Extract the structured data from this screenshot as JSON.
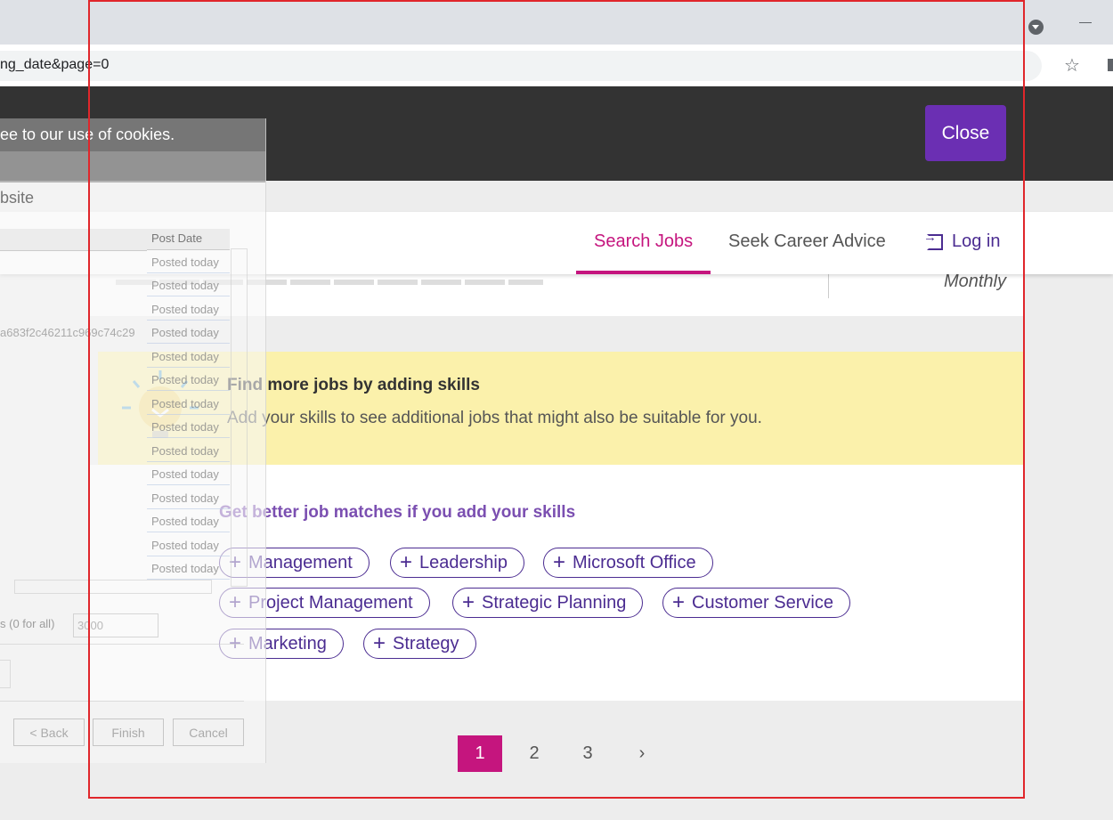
{
  "browser": {
    "url_fragment": "ng_date&page=0",
    "bookmark_icon": "star-icon",
    "profile_icon": "profile-dropdown-icon"
  },
  "cookie_banner": {
    "message": "ee to our use of cookies.",
    "close_label": "Close"
  },
  "nav": {
    "items": [
      {
        "label": "Search Jobs",
        "active": true
      },
      {
        "label": "Seek Career Advice",
        "active": false
      }
    ],
    "login_label": "Log in",
    "login_icon": "login-icon",
    "accent_color": "#c5157e"
  },
  "job_card": {
    "salary_period": "Monthly"
  },
  "skills_banner": {
    "title": "Find more jobs by adding skills",
    "text": "Add your skills to see additional jobs that might also be suitable for you.",
    "icon": "lightbulb-icon",
    "background": "#fbf1ab"
  },
  "skills": {
    "heading": "Get better job matches if you add your skills",
    "chips": [
      "Management",
      "Leadership",
      "Microsoft Office",
      "Project Management",
      "Strategic Planning",
      "Customer Service",
      "Marketing",
      "Strategy"
    ],
    "brand_color": "#4b2c91"
  },
  "pagination": {
    "pages": [
      "1",
      "2",
      "3"
    ],
    "current": "1",
    "next": "›"
  },
  "overlay_dialog": {
    "title": "ee to our use of cookies.",
    "website_label": "bsite",
    "column_header": "Post Date",
    "rows": [
      "Posted today",
      "Posted today",
      "Posted today",
      "Posted today",
      "Posted today",
      "Posted today",
      "Posted today",
      "Posted today",
      "Posted today",
      "Posted today",
      "Posted today",
      "Posted today",
      "Posted today",
      "Posted today"
    ],
    "hash_text": "a683f2c46211c969c74c29",
    "limit_label": "s (0 for all)",
    "limit_value": "3000",
    "back_label": "< Back",
    "finish_label": "Finish",
    "cancel_label": "Cancel"
  }
}
